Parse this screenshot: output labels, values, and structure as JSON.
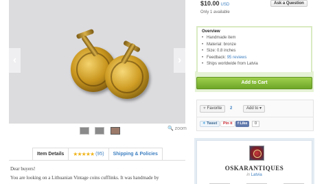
{
  "gallery": {
    "prev_arrow": "‹",
    "next_arrow": "›",
    "zoom_label": "zoom",
    "zoom_icon": "🔍",
    "thumbnails": 3
  },
  "tabs": {
    "item_details": "Item Details",
    "reviews_stars": "★★★★★",
    "reviews_count": "(95)",
    "shipping": "Shipping & Policies"
  },
  "description": {
    "line1": "Dear buyers!",
    "line2": "You are looking on a Lithuanian Vintage coins cufflinks. It was handmade by"
  },
  "listing": {
    "price": "$10.00",
    "currency": "USD",
    "ask_button": "Ask a Question",
    "availability": "Only 1 available"
  },
  "overview": {
    "heading": "Overview",
    "items": {
      "i0": "Handmade item",
      "i1": "Material: bronze",
      "i2": "Size: 0.8 inches",
      "i3_prefix": "Feedback: ",
      "i3_link": "95 reviews",
      "i4": "Ships worldwide from Latvia"
    }
  },
  "cart": {
    "label": "Add to Cart"
  },
  "social": {
    "favorite_label": "Favorite",
    "favorite_icon": "♥",
    "favorite_count": "2",
    "add_to_label": "Add to",
    "add_to_arrow": "▾",
    "tweet_label": "Tweet",
    "pinit_label": "Pin it",
    "fb_like_label": "Like",
    "fb_count": "0"
  },
  "shop": {
    "name": "OSKARANTIQUES",
    "in_label": "in",
    "location": "Latvia"
  }
}
